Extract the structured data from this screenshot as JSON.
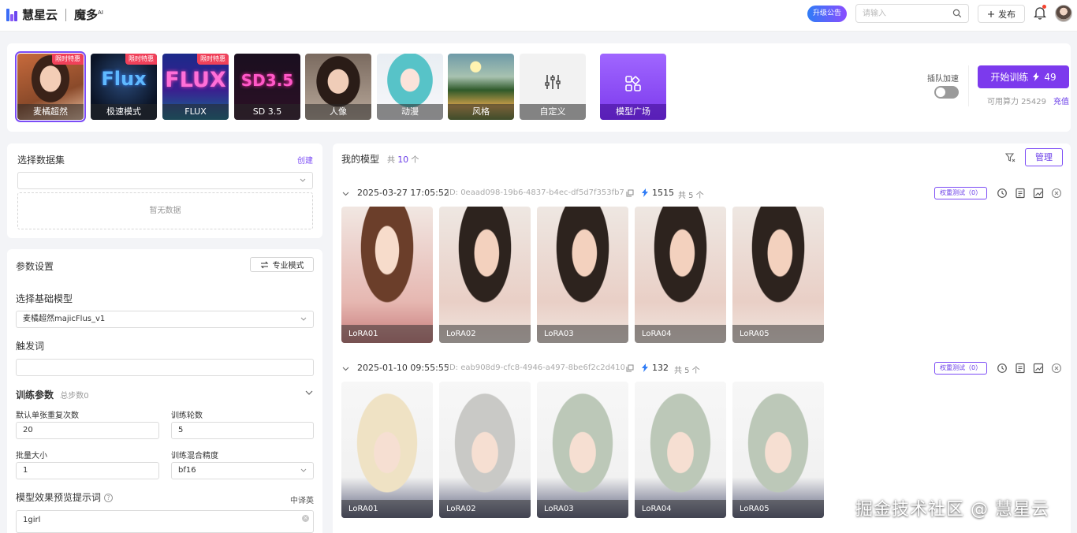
{
  "header": {
    "brand": "慧星云",
    "product": "魔多",
    "product_sup": "AI",
    "announcement": "升级公告",
    "search_placeholder": "请输入",
    "publish_label": "发布"
  },
  "models": {
    "cards": [
      {
        "label": "麦橘超然",
        "badge": "限时特惠"
      },
      {
        "label": "极速模式",
        "badge": "限时特惠",
        "art_text": "Flux"
      },
      {
        "label": "FLUX",
        "badge": "限时特惠",
        "art_text": "FLUX"
      },
      {
        "label": "SD 3.5",
        "art_text": "SD3.5"
      },
      {
        "label": "人像"
      },
      {
        "label": "动漫"
      },
      {
        "label": "风格"
      },
      {
        "label": "自定义"
      },
      {
        "label": "模型广场"
      }
    ],
    "queue_label": "插队加速",
    "queue_enabled": false,
    "train_label": "开始训练",
    "train_cost": "49",
    "compute_label": "可用算力 25429",
    "recharge_label": "充值"
  },
  "dataset": {
    "title": "选择数据集",
    "create_label": "创建",
    "empty_text": "暂无数据"
  },
  "params": {
    "title": "参数设置",
    "pro_mode_label": "专业模式",
    "base_model_label": "选择基础模型",
    "base_model_value": "麦橘超然majicFlus_v1",
    "trigger_label": "触发词",
    "trigger_value": "",
    "training_label": "训练参数",
    "steps_label": "总步数0",
    "repeat_label": "默认单张重复次数",
    "repeat_value": "20",
    "epochs_label": "训练轮数",
    "epochs_value": "5",
    "batch_label": "批量大小",
    "batch_value": "1",
    "precision_label": "训练混合精度",
    "precision_value": "bf16",
    "prompt_label": "模型效果预览提示词",
    "translate_label": "中译英",
    "prompt_value": "1girl"
  },
  "my_models": {
    "title": "我的模型",
    "total_prefix": "共",
    "total": "10",
    "total_suffix": "个",
    "manage_label": "管理",
    "groups": [
      {
        "date": "2025-03-27 17:05:52",
        "id": "ID: 0eaad098-19b6-4837-b4ec-df5d7f353fb7",
        "power": "1515",
        "count": "共 5 个",
        "weight_test": "权重测试（0）",
        "items": [
          "LoRA01",
          "LoRA02",
          "LoRA03",
          "LoRA04",
          "LoRA05"
        ]
      },
      {
        "date": "2025-01-10 09:55:55",
        "id": "ID: eab908d9-cfc8-4946-a497-8be6f2c2d410",
        "power": "132",
        "count": "共 5 个",
        "weight_test": "权重测试（0）",
        "items": [
          "LoRA01",
          "LoRA02",
          "LoRA03",
          "LoRA04",
          "LoRA05"
        ]
      }
    ]
  },
  "watermark": "掘金技术社区 @ 慧星云",
  "colors": {
    "accent": "#7c3aed",
    "accent_text": "#6a3de8",
    "promo": "#f0415a",
    "lightning": "#2f7cf6"
  }
}
